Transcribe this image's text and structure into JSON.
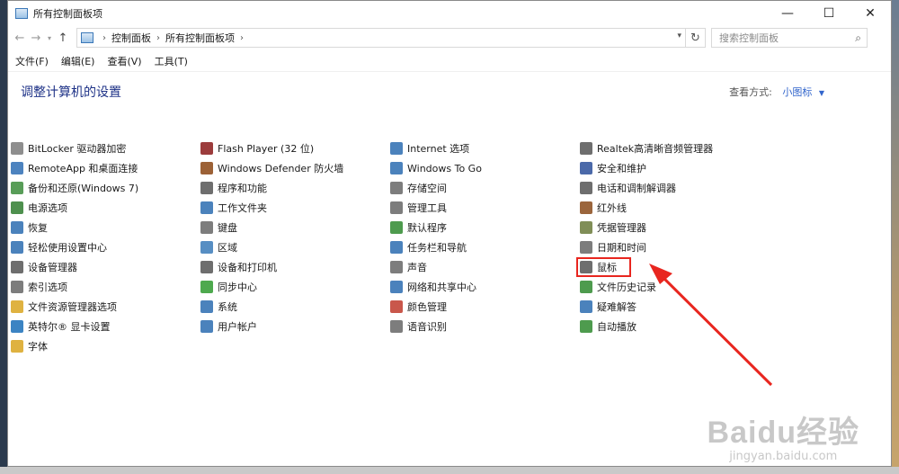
{
  "window": {
    "title": "所有控制面板项",
    "controls": {
      "minimize": "—",
      "maximize": "☐",
      "close": "✕"
    }
  },
  "address": {
    "crumbs": [
      "控制面板",
      "所有控制面板项"
    ],
    "search_placeholder": "搜索控制面板"
  },
  "menu": [
    "文件(F)",
    "编辑(E)",
    "查看(V)",
    "工具(T)"
  ],
  "header": {
    "title": "调整计算机的设置",
    "view_label": "查看方式:",
    "view_value": "小图标"
  },
  "columns": [
    [
      {
        "label": "BitLocker 驱动器加密",
        "icon": "bitlocker-icon",
        "color": "#7a7a7a"
      },
      {
        "label": "RemoteApp 和桌面连接",
        "icon": "remoteapp-icon",
        "color": "#2e6db4"
      },
      {
        "label": "备份和还原(Windows 7)",
        "icon": "backup-icon",
        "color": "#3b8c3b"
      },
      {
        "label": "电源选项",
        "icon": "power-icon",
        "color": "#2f7d2f"
      },
      {
        "label": "恢复",
        "icon": "recovery-icon",
        "color": "#2b6cb0"
      },
      {
        "label": "轻松使用设置中心",
        "icon": "ease-of-access-icon",
        "color": "#2b6cb0"
      },
      {
        "label": "设备管理器",
        "icon": "device-manager-icon",
        "color": "#555555"
      },
      {
        "label": "索引选项",
        "icon": "indexing-icon",
        "color": "#666666"
      },
      {
        "label": "文件资源管理器选项",
        "icon": "folder-options-icon",
        "color": "#d9a520"
      },
      {
        "label": "英特尔® 显卡设置",
        "icon": "intel-graphics-icon",
        "color": "#1a6fb8"
      },
      {
        "label": "字体",
        "icon": "fonts-icon",
        "color": "#d9a520"
      }
    ],
    [
      {
        "label": "Flash Player (32 位)",
        "icon": "flash-icon",
        "color": "#8b1a1a"
      },
      {
        "label": "Windows Defender 防火墙",
        "icon": "firewall-icon",
        "color": "#8b4513"
      },
      {
        "label": "程序和功能",
        "icon": "programs-icon",
        "color": "#555555"
      },
      {
        "label": "工作文件夹",
        "icon": "work-folders-icon",
        "color": "#2b6cb0"
      },
      {
        "label": "键盘",
        "icon": "keyboard-icon",
        "color": "#666666"
      },
      {
        "label": "区域",
        "icon": "region-icon",
        "color": "#3a7ab8"
      },
      {
        "label": "设备和打印机",
        "icon": "printer-icon",
        "color": "#555555"
      },
      {
        "label": "同步中心",
        "icon": "sync-icon",
        "color": "#2f9a2f"
      },
      {
        "label": "系统",
        "icon": "system-icon",
        "color": "#2b6cb0"
      },
      {
        "label": "用户帐户",
        "icon": "user-accounts-icon",
        "color": "#2b6cb0"
      }
    ],
    [
      {
        "label": "Internet 选项",
        "icon": "internet-options-icon",
        "color": "#2b6cb0"
      },
      {
        "label": "Windows To Go",
        "icon": "windows-to-go-icon",
        "color": "#2b6cb0"
      },
      {
        "label": "存储空间",
        "icon": "storage-icon",
        "color": "#666666"
      },
      {
        "label": "管理工具",
        "icon": "admin-tools-icon",
        "color": "#666666"
      },
      {
        "label": "默认程序",
        "icon": "default-programs-icon",
        "color": "#2f8a2f"
      },
      {
        "label": "任务栏和导航",
        "icon": "taskbar-icon",
        "color": "#2b6cb0"
      },
      {
        "label": "声音",
        "icon": "sound-icon",
        "color": "#666666"
      },
      {
        "label": "网络和共享中心",
        "icon": "network-icon",
        "color": "#2b6cb0"
      },
      {
        "label": "颜色管理",
        "icon": "color-management-icon",
        "color": "#c0392b"
      },
      {
        "label": "语音识别",
        "icon": "speech-icon",
        "color": "#666666"
      }
    ],
    [
      {
        "label": "Realtek高清晰音频管理器",
        "icon": "realtek-icon",
        "color": "#555555"
      },
      {
        "label": "安全和维护",
        "icon": "security-flag-icon",
        "color": "#2b4f9a"
      },
      {
        "label": "电话和调制解调器",
        "icon": "phone-modem-icon",
        "color": "#555555"
      },
      {
        "label": "红外线",
        "icon": "infrared-icon",
        "color": "#8a4a1a"
      },
      {
        "label": "凭据管理器",
        "icon": "credential-icon",
        "color": "#6a7a3a"
      },
      {
        "label": "日期和时间",
        "icon": "clock-icon",
        "color": "#666666"
      },
      {
        "label": "鼠标",
        "icon": "mouse-icon",
        "color": "#555555",
        "highlight": true
      },
      {
        "label": "文件历史记录",
        "icon": "file-history-icon",
        "color": "#2f8a2f"
      },
      {
        "label": "疑难解答",
        "icon": "troubleshoot-icon",
        "color": "#2b6cb0"
      },
      {
        "label": "自动播放",
        "icon": "autoplay-icon",
        "color": "#2f8a2f"
      }
    ]
  ],
  "annotation": {
    "color": "#e8261f"
  },
  "watermark": {
    "logo": "Baidu经验",
    "sub": "jingyan.baidu.com"
  }
}
